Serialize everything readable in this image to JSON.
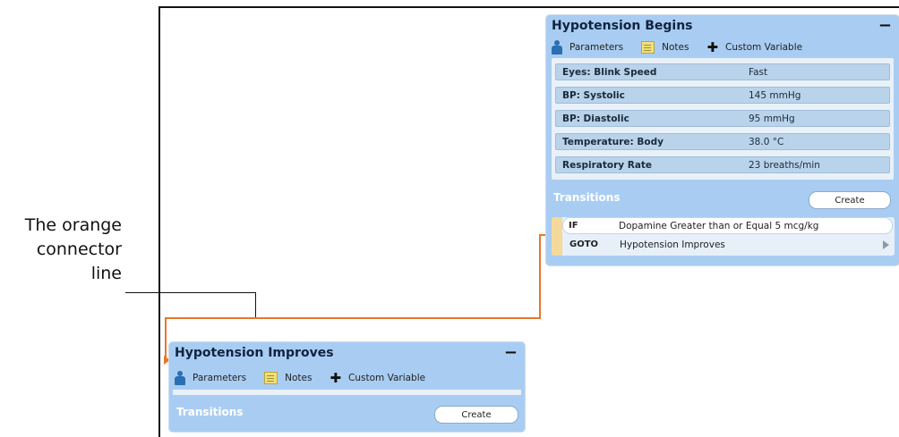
{
  "callout": {
    "line1": "The orange",
    "line2": "connector",
    "line3": "line"
  },
  "colors": {
    "connector": "#e8762a",
    "panel": "#a9cdf2",
    "param_row": "#b9d3ea"
  },
  "icons": [
    "person-icon",
    "notes-icon",
    "plus-icon",
    "collapse-icon",
    "play-icon",
    "arrow-icon"
  ],
  "panel_begins": {
    "title": "Hypotension Begins",
    "collapse": "−",
    "toolbar": {
      "parameters": "Parameters",
      "notes": "Notes",
      "custom_variable": "Custom Variable"
    },
    "params": [
      {
        "name": "Eyes: Blink Speed",
        "value": "Fast"
      },
      {
        "name": "BP: Systolic",
        "value": "145 mmHg"
      },
      {
        "name": "BP: Diastolic",
        "value": "95 mmHg"
      },
      {
        "name": "Temperature: Body",
        "value": "38.0 °C"
      },
      {
        "name": "Respiratory Rate",
        "value": "23 breaths/min"
      }
    ],
    "transitions_title": "Transitions",
    "create_label": "Create",
    "transition": {
      "if_kw": "IF",
      "condition": "Dopamine Greater than or Equal 5 mcg/kg",
      "goto_kw": "GOTO",
      "target": "Hypotension Improves"
    }
  },
  "panel_improves": {
    "title": "Hypotension Improves",
    "collapse": "−",
    "toolbar": {
      "parameters": "Parameters",
      "notes": "Notes",
      "custom_variable": "Custom Variable"
    },
    "transitions_title": "Transitions",
    "create_label": "Create"
  }
}
